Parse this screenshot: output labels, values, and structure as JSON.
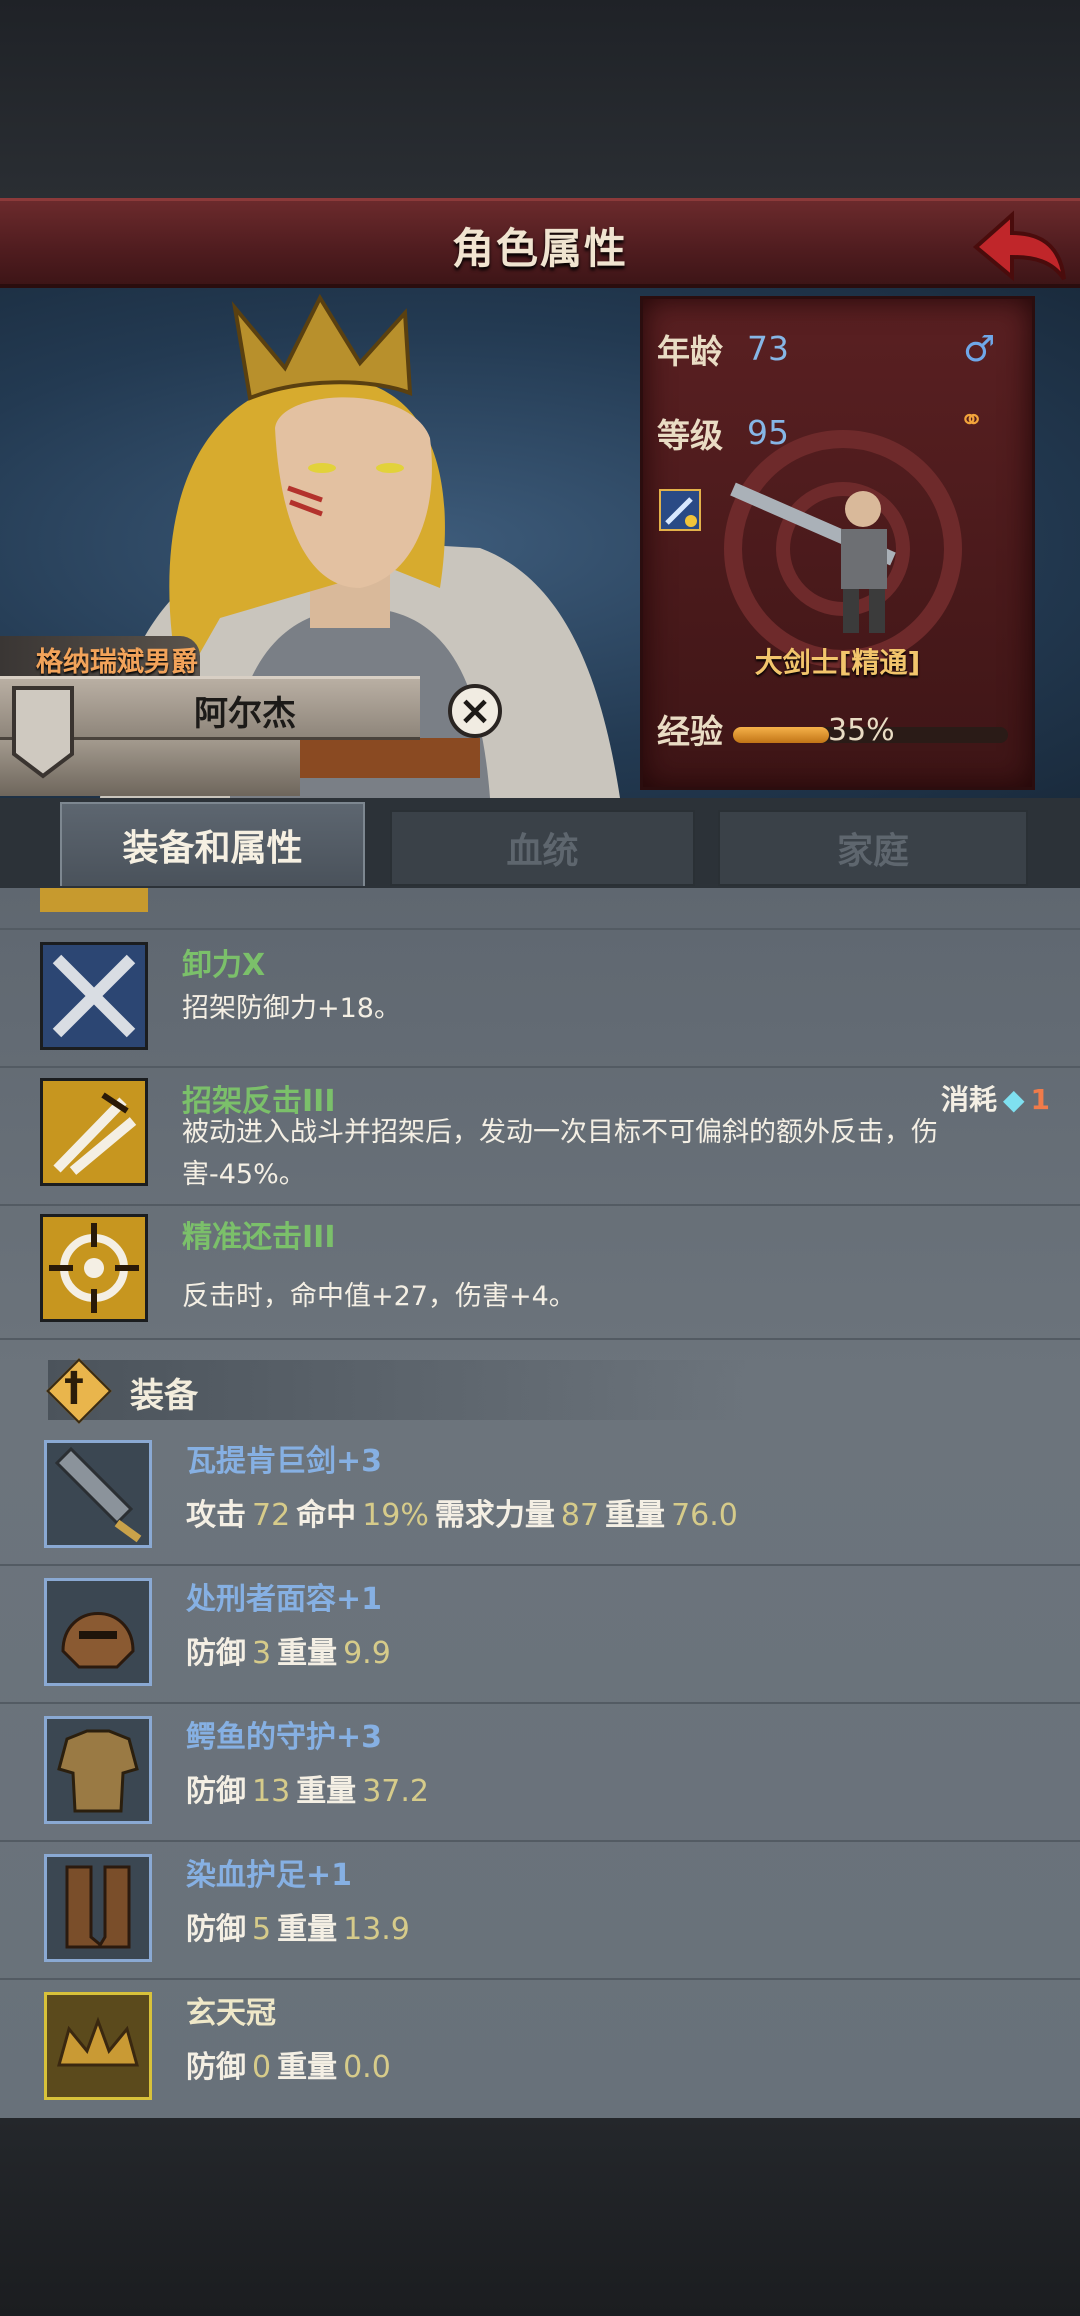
{
  "header": {
    "title": "角色属性"
  },
  "character": {
    "title_text": "格纳瑞斌男爵",
    "name": "阿尔杰",
    "age_label": "年龄",
    "age": "73",
    "level_label": "等级",
    "level": "95",
    "class_name": "大剑士[精通]",
    "exp_label": "经验",
    "exp_percent": "35%",
    "exp_fraction": 0.35
  },
  "tabs": [
    {
      "label": "装备和属性",
      "active": true
    },
    {
      "label": "血统",
      "active": false
    },
    {
      "label": "家庭",
      "active": false
    }
  ],
  "skills": [
    {
      "name": "卸力X",
      "desc": "招架防御力+18。",
      "icon": "crossed-swords-icon"
    },
    {
      "name": "招架反击III",
      "desc": "被动进入战斗并招架后，发动一次目标不可偏斜的额外反击，伤害-45%。",
      "cost_label": "消耗",
      "cost_value": "1",
      "icon": "parry-icon"
    },
    {
      "name": "精准还击III",
      "desc": "反击时，命中值+27，伤害+4。",
      "icon": "target-icon"
    }
  ],
  "equipment_section": {
    "title": "装备"
  },
  "equipment": [
    {
      "name": "瓦提肯巨剑+3",
      "stats": [
        [
          "攻击",
          "72"
        ],
        [
          "命中",
          "19%"
        ],
        [
          "需求力量",
          "87"
        ],
        [
          "重量",
          "76.0"
        ]
      ],
      "icon": "greatsword-icon"
    },
    {
      "name": "处刑者面容+1",
      "stats": [
        [
          "防御",
          "3"
        ],
        [
          "重量",
          "9.9"
        ]
      ],
      "icon": "helmet-icon"
    },
    {
      "name": "鳄鱼的守护+3",
      "stats": [
        [
          "防御",
          "13"
        ],
        [
          "重量",
          "37.2"
        ]
      ],
      "icon": "armor-icon"
    },
    {
      "name": "染血护足+1",
      "stats": [
        [
          "防御",
          "5"
        ],
        [
          "重量",
          "13.9"
        ]
      ],
      "icon": "boots-icon"
    },
    {
      "name": "玄天冠",
      "stats": [
        [
          "防御",
          "0"
        ],
        [
          "重量",
          "0.0"
        ]
      ],
      "icon": "crown-icon"
    }
  ]
}
